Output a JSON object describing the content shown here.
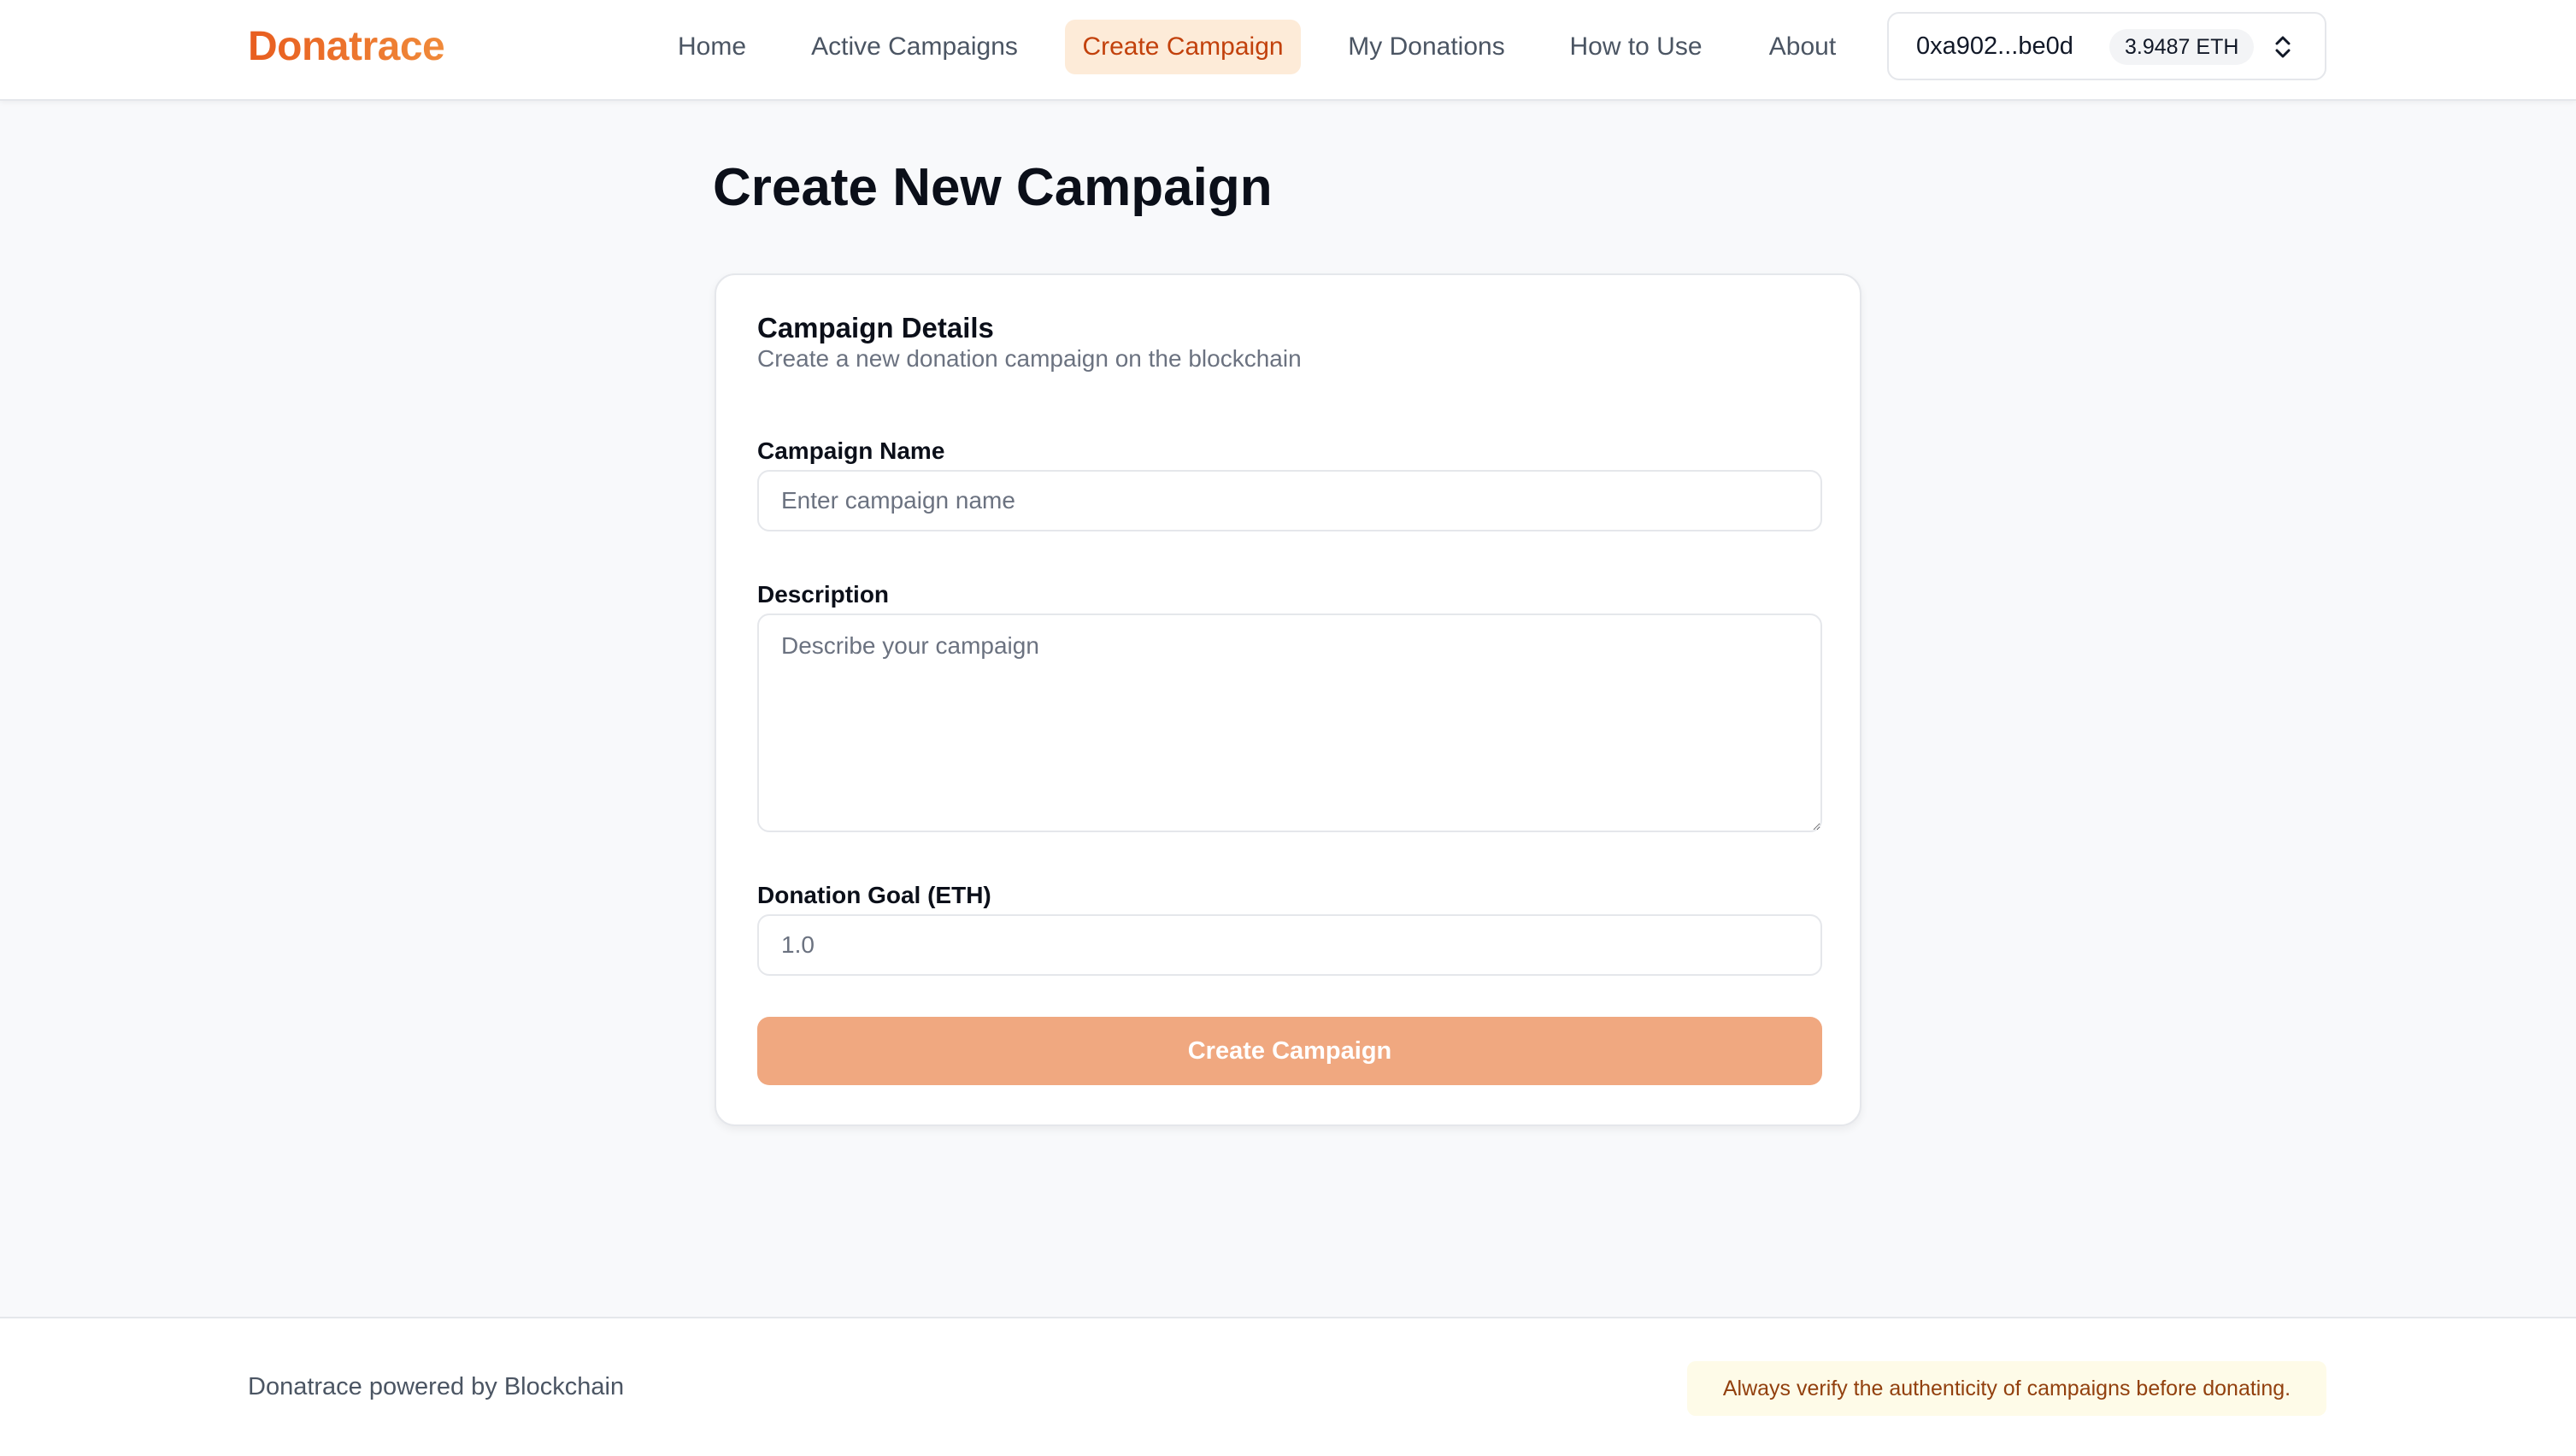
{
  "header": {
    "logo": "Donatrace",
    "nav": [
      {
        "label": "Home",
        "active": false
      },
      {
        "label": "Active Campaigns",
        "active": false
      },
      {
        "label": "Create Campaign",
        "active": true
      },
      {
        "label": "My Donations",
        "active": false
      },
      {
        "label": "How to Use",
        "active": false
      },
      {
        "label": "About",
        "active": false
      }
    ],
    "wallet": {
      "address": "0xa902...be0d",
      "balance": "3.9487 ETH",
      "toggle_icon": "chevron-up-down-icon"
    }
  },
  "main": {
    "title": "Create New Campaign",
    "card": {
      "title": "Campaign Details",
      "subtitle": "Create a new donation campaign on the blockchain",
      "fields": {
        "name": {
          "label": "Campaign Name",
          "placeholder": "Enter campaign name",
          "value": ""
        },
        "description": {
          "label": "Description",
          "placeholder": "Describe your campaign",
          "value": ""
        },
        "goal": {
          "label": "Donation Goal (ETH)",
          "placeholder": "1.0",
          "value": ""
        }
      },
      "submit_label": "Create Campaign"
    }
  },
  "footer": {
    "text": "Donatrace powered by Blockchain",
    "warning": "Always verify the authenticity of campaigns before donating."
  },
  "colors": {
    "brand": "#e85d1f",
    "active_nav_bg": "#fdebd8",
    "active_nav_text": "#c2410c",
    "button_disabled": "#f0a880",
    "warning_bg": "#fefbe8",
    "warning_text": "#92400e"
  }
}
